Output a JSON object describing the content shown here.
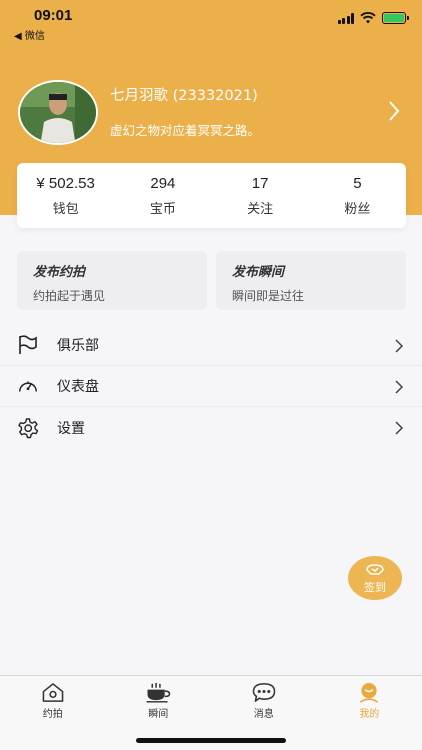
{
  "status_bar": {
    "time": "09:01",
    "back_app": "◀ 微信",
    "icons": [
      "signal-icon",
      "wifi-icon",
      "battery-charging-icon"
    ]
  },
  "profile": {
    "name": "七月羽歌 (23332021)",
    "bio": "虚幻之物对应着冥冥之路。",
    "avatar": "avatar-photo"
  },
  "stats": [
    {
      "value": "¥ 502.53",
      "label": "钱包"
    },
    {
      "value": "294",
      "label": "宝币"
    },
    {
      "value": "17",
      "label": "关注"
    },
    {
      "value": "5",
      "label": "粉丝"
    }
  ],
  "quick_actions": [
    {
      "title": "发布约拍",
      "subtitle": "约拍起于遇见"
    },
    {
      "title": "发布瞬间",
      "subtitle": "瞬间即是过往"
    }
  ],
  "menu": [
    {
      "label": "俱乐部",
      "icon": "flag-icon"
    },
    {
      "label": "仪表盘",
      "icon": "gauge-icon"
    },
    {
      "label": "设置",
      "icon": "gear-icon"
    }
  ],
  "signin_button": {
    "label": "签到",
    "icon": "sign-in-icon"
  },
  "tabbar": {
    "tabs": [
      {
        "label": "约拍",
        "icon": "home-icon",
        "active": false
      },
      {
        "label": "瞬间",
        "icon": "coffee-cup-icon",
        "active": false
      },
      {
        "label": "消息",
        "icon": "chat-bubble-icon",
        "active": false
      },
      {
        "label": "我的",
        "icon": "smile-face-icon",
        "active": true
      }
    ]
  },
  "colors": {
    "accent": "#ebb04a",
    "active_tab": "#e8a93e",
    "background": "#f6f6f8"
  }
}
